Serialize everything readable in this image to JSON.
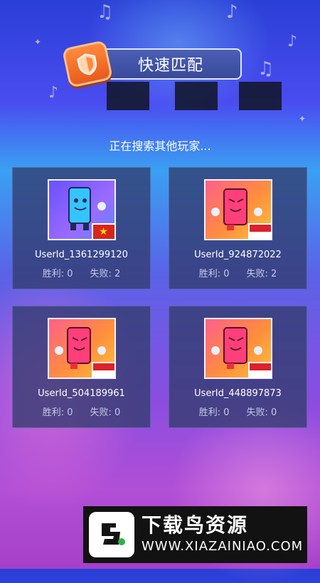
{
  "header": {
    "title": "快速匹配",
    "badge_icon": "shield-icon"
  },
  "status_text": "正在搜索其他玩家...",
  "players": [
    {
      "user_id": "UserId_1361299120",
      "wins": "胜利: 0",
      "losses": "失败: 2",
      "flag": "vietnam-flag",
      "avatar": "blue"
    },
    {
      "user_id": "UserId_924872022",
      "wins": "胜利: 0",
      "losses": "失败: 2",
      "flag": "indonesia-flag",
      "avatar": "orange"
    },
    {
      "user_id": "UserId_504189961",
      "wins": "胜利: 0",
      "losses": "失败: 0",
      "flag": "indonesia-flag",
      "avatar": "orange"
    },
    {
      "user_id": "UserId_448897873",
      "wins": "胜利: 0",
      "losses": "失败: 0",
      "flag": "indonesia-flag",
      "avatar": "orange"
    }
  ],
  "footer": {
    "title": "下载鸟资源",
    "url": "WWW.XIAZAINIAO.COM"
  },
  "colors": {
    "card_bg": "#323c6e",
    "badge": "#e95a1b",
    "header_bg": "#3a4a99"
  }
}
